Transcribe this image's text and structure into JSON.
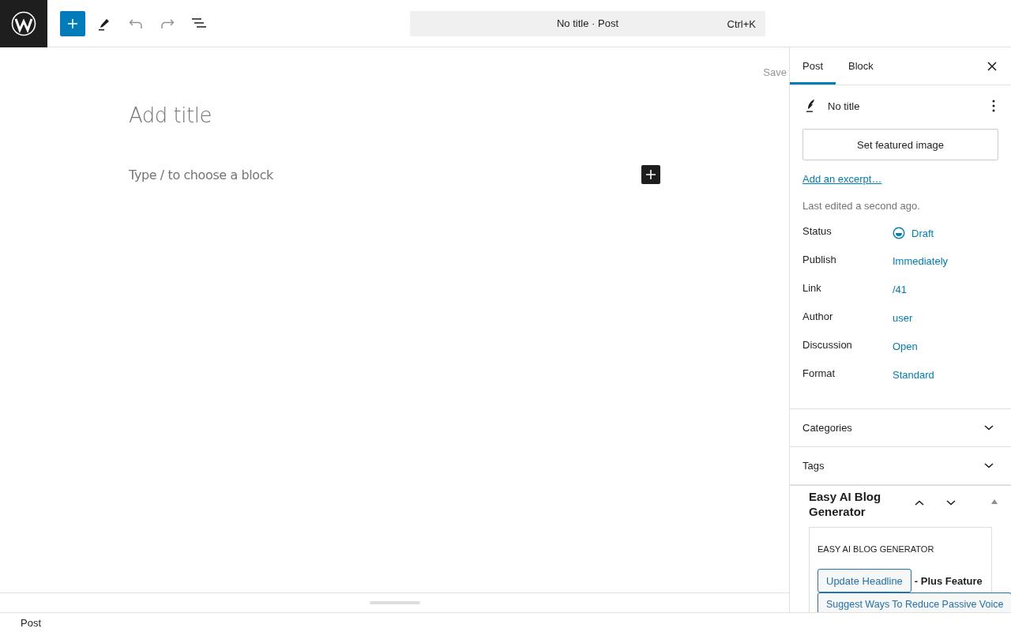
{
  "toolbar": {
    "document_title": "No title · Post",
    "shortcut": "Ctrl+K"
  },
  "editor": {
    "save_label": "Save",
    "title_placeholder": "Add title",
    "block_placeholder": "Type / to choose a block"
  },
  "sidebar": {
    "tabs": [
      {
        "label": "Post",
        "selected": true
      },
      {
        "label": "Block",
        "selected": false
      }
    ],
    "post_title": "No title",
    "featured_image_button": "Set featured image",
    "excerpt_link": "Add an excerpt…",
    "last_edited": "Last edited a second ago.",
    "fields": [
      {
        "label": "Status",
        "value": "Draft",
        "kind": "status"
      },
      {
        "label": "Publish",
        "value": "Immediately",
        "kind": "link"
      },
      {
        "label": "Link",
        "value": "/41",
        "kind": "link"
      },
      {
        "label": "Author",
        "value": "user",
        "kind": "link"
      },
      {
        "label": "Discussion",
        "value": "Open",
        "kind": "link"
      },
      {
        "label": "Format",
        "value": "Standard",
        "kind": "link"
      }
    ],
    "panels": [
      {
        "title": "Categories",
        "expanded": false
      },
      {
        "title": "Tags",
        "expanded": false
      }
    ],
    "plugin": {
      "title": "Easy AI Blog Generator",
      "expanded": true,
      "heading": "EASY AI BLOG GENERATOR",
      "actions": [
        {
          "label": "Update Headline",
          "note": "- Plus Feature"
        },
        {
          "label": "Suggest Ways To Reduce Passive Voice"
        }
      ]
    }
  },
  "footer": {
    "breadcrumb": "Post"
  }
}
